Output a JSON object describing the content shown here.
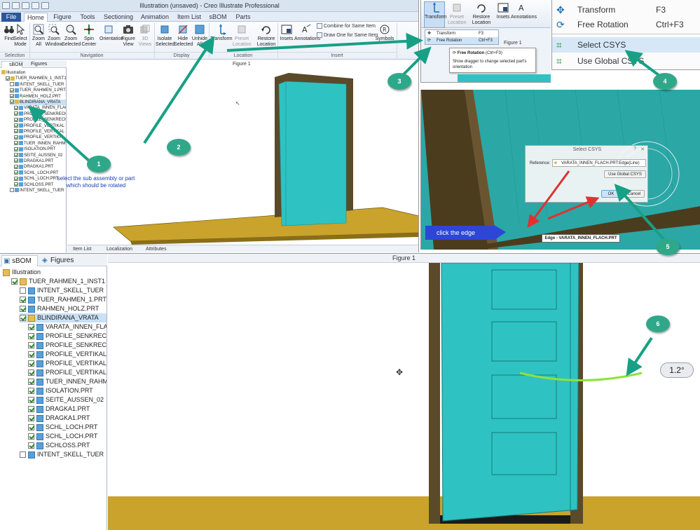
{
  "main_window": {
    "title": "Illustration (unsaved) - Creo Illustrate Professional",
    "tabs": [
      "File",
      "Home",
      "Figure",
      "Tools",
      "Sectioning",
      "Animation",
      "Item List",
      "sBOM",
      "Parts"
    ],
    "ribbon": {
      "buttons": [
        {
          "label": "Find"
        },
        {
          "label": "Select Mode"
        },
        {
          "label": "Zoom All"
        },
        {
          "label": "Zoom Window"
        },
        {
          "label": "Zoom Selected"
        },
        {
          "label": "Spin Center"
        },
        {
          "label": "Orientation"
        },
        {
          "label": "Figure View"
        },
        {
          "label": "3D Views"
        },
        {
          "label": "Isolate Selected"
        },
        {
          "label": "Hide Selected"
        },
        {
          "label": "Unhide All"
        },
        {
          "label": "Transform"
        },
        {
          "label": "Preset Location"
        },
        {
          "label": "Restore Location"
        },
        {
          "label": "Insets"
        },
        {
          "label": "Annotations"
        },
        {
          "label": "Symbols"
        }
      ],
      "small_commands": [
        "Combine for Same Item",
        "Draw One for Same Item"
      ],
      "groups": [
        "Selection",
        "Navigation",
        "Display",
        "Location",
        "Insert"
      ]
    },
    "panel_tabs": [
      "sBOM",
      "Figures"
    ],
    "figure_label": "Figure 1",
    "bottom_tabs": [
      "Item List",
      "Localization",
      "Attributes"
    ]
  },
  "tree": {
    "root": "Illustration",
    "items": [
      {
        "label": "TUER_RAHMEN_1_INST1",
        "checked": true,
        "icon": "assembly",
        "level": 1,
        "expanded": true
      },
      {
        "label": "INTENT_SKELL_TUER",
        "checked": false,
        "icon": "part",
        "level": 2
      },
      {
        "label": "TUER_RAHMEN_1.PRT",
        "checked": true,
        "icon": "part",
        "level": 2
      },
      {
        "label": "RAHMEN_HOLZ.PRT",
        "checked": true,
        "icon": "part",
        "level": 2
      },
      {
        "label": "BLINDIRANA_VRATA",
        "checked": true,
        "icon": "assembly",
        "level": 2,
        "expanded": true,
        "selected": true
      },
      {
        "label": "VARATA_INNEN_FLACH",
        "checked": true,
        "icon": "part",
        "level": 3
      },
      {
        "label": "PROFILE_SENKRECHT",
        "checked": true,
        "icon": "part",
        "level": 3
      },
      {
        "label": "PROFILE_SENKRECHT",
        "checked": true,
        "icon": "part",
        "level": 3
      },
      {
        "label": "PROFILE_VERTIKAL",
        "checked": true,
        "icon": "part",
        "level": 3
      },
      {
        "label": "PROFILE_VERTIKAL",
        "checked": true,
        "icon": "part",
        "level": 3
      },
      {
        "label": "PROFILE_VERTIKAL",
        "checked": true,
        "icon": "part",
        "level": 3
      },
      {
        "label": "TUER_INNEN_RAHMEN",
        "checked": true,
        "icon": "part",
        "level": 3
      },
      {
        "label": "ISOLATION.PRT",
        "checked": true,
        "icon": "part",
        "level": 3
      },
      {
        "label": "SEITE_AUSSEN_02",
        "checked": true,
        "icon": "part",
        "level": 3
      },
      {
        "label": "DRAGKA1.PRT",
        "checked": true,
        "icon": "part",
        "level": 3
      },
      {
        "label": "DRAGKA1.PRT",
        "checked": true,
        "icon": "part",
        "level": 3
      },
      {
        "label": "SCHL_LOCH.PRT",
        "checked": true,
        "icon": "part",
        "level": 3
      },
      {
        "label": "SCHL_LOCH.PRT",
        "checked": true,
        "icon": "part",
        "level": 3
      },
      {
        "label": "SCHLOSS.PRT",
        "checked": true,
        "icon": "part",
        "level": 3
      },
      {
        "label": "INTENT_SKELL_TUER",
        "checked": false,
        "icon": "part",
        "level": 2
      }
    ]
  },
  "transform_menu": {
    "button_label": "Transform",
    "header_buttons": [
      "Transform",
      "Preset Location",
      "Restore Location",
      "Insets",
      "Annotations"
    ],
    "items": [
      {
        "label": "Transform",
        "shortcut": "F3"
      },
      {
        "label": "Free Rotation",
        "shortcut": "Ctrl+F3",
        "highlighted": true
      }
    ],
    "tooltip_title": "Free Rotation",
    "tooltip_shortcut": "(Ctrl+F3)",
    "tooltip_body": "Show dragger to change selected part's orientation",
    "figure_label": "Figure 1"
  },
  "zoom_menu": {
    "items": [
      {
        "label": "Transform",
        "shortcut": "F3"
      },
      {
        "label": "Free Rotation",
        "shortcut": "Ctrl+F3"
      },
      {
        "label": "Select CSYS",
        "shortcut": "",
        "highlighted": true
      },
      {
        "label": "Use Global CSYS",
        "shortcut": ""
      }
    ]
  },
  "csys_dialog": {
    "title": "Select CSYS",
    "reference_label": "Reference:",
    "reference_value": "VARATA_INNEN_FLACH.PRT:Edge(Line)",
    "use_global_button": "Use Global CSYS",
    "ok_button": "OK",
    "cancel_button": "Cancel",
    "edge_tooltip": "Edge - VARATA_INNEN_FLACH.PRT"
  },
  "bottom_view": {
    "panel_tabs": [
      "sBOM",
      "Figures"
    ],
    "figure_label": "Figure 1",
    "angle": "1.2°"
  },
  "annotations": {
    "callouts": [
      "1",
      "2",
      "3",
      "4",
      "5",
      "6"
    ],
    "note_select": "select the sub assembly or part which should be rotated",
    "note_click_edge": "click the edge"
  },
  "colors": {
    "door_cyan": "#2fc2c2",
    "frame_brown": "#5a4a2a",
    "floor_gold": "#c9a32b",
    "callout_green": "#2fa88a",
    "arrow_green": "#17a085",
    "arrow_red": "#e03131",
    "rotation_arc": "#8ee23a"
  }
}
